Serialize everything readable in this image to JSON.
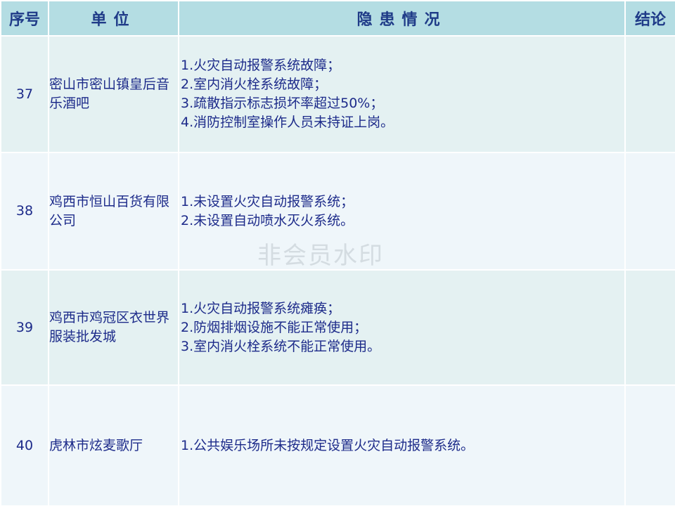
{
  "header": {
    "no": "序号",
    "unit": "单位",
    "issue": "隐患情况",
    "result": "结论"
  },
  "rows": [
    {
      "no": "37",
      "unit": "密山市密山镇皇后音乐酒吧",
      "issues": [
        "1.火灾自动报警系统故障；",
        "2.室内消火栓系统故障；",
        "3.疏散指示标志损坏率超过50%；",
        "4.消防控制室操作人员未持证上岗。"
      ],
      "result": ""
    },
    {
      "no": "38",
      "unit": "鸡西市恒山百货有限公司",
      "issues": [
        "1.未设置火灾自动报警系统；",
        "2.未设置自动喷水灭火系统。"
      ],
      "result": ""
    },
    {
      "no": "39",
      "unit": "鸡西市鸡冠区衣世界服装批发城",
      "issues": [
        "1.火灾自动报警系统瘫痪；",
        "2.防烟排烟设施不能正常使用；",
        "3.室内消火栓系统不能正常使用。"
      ],
      "result": ""
    },
    {
      "no": "40",
      "unit": "虎林市炫麦歌厅",
      "issues": [
        "1.公共娱乐场所未按规定设置火灾自动报警系统。"
      ],
      "result": ""
    }
  ],
  "watermark": "非会员水印"
}
